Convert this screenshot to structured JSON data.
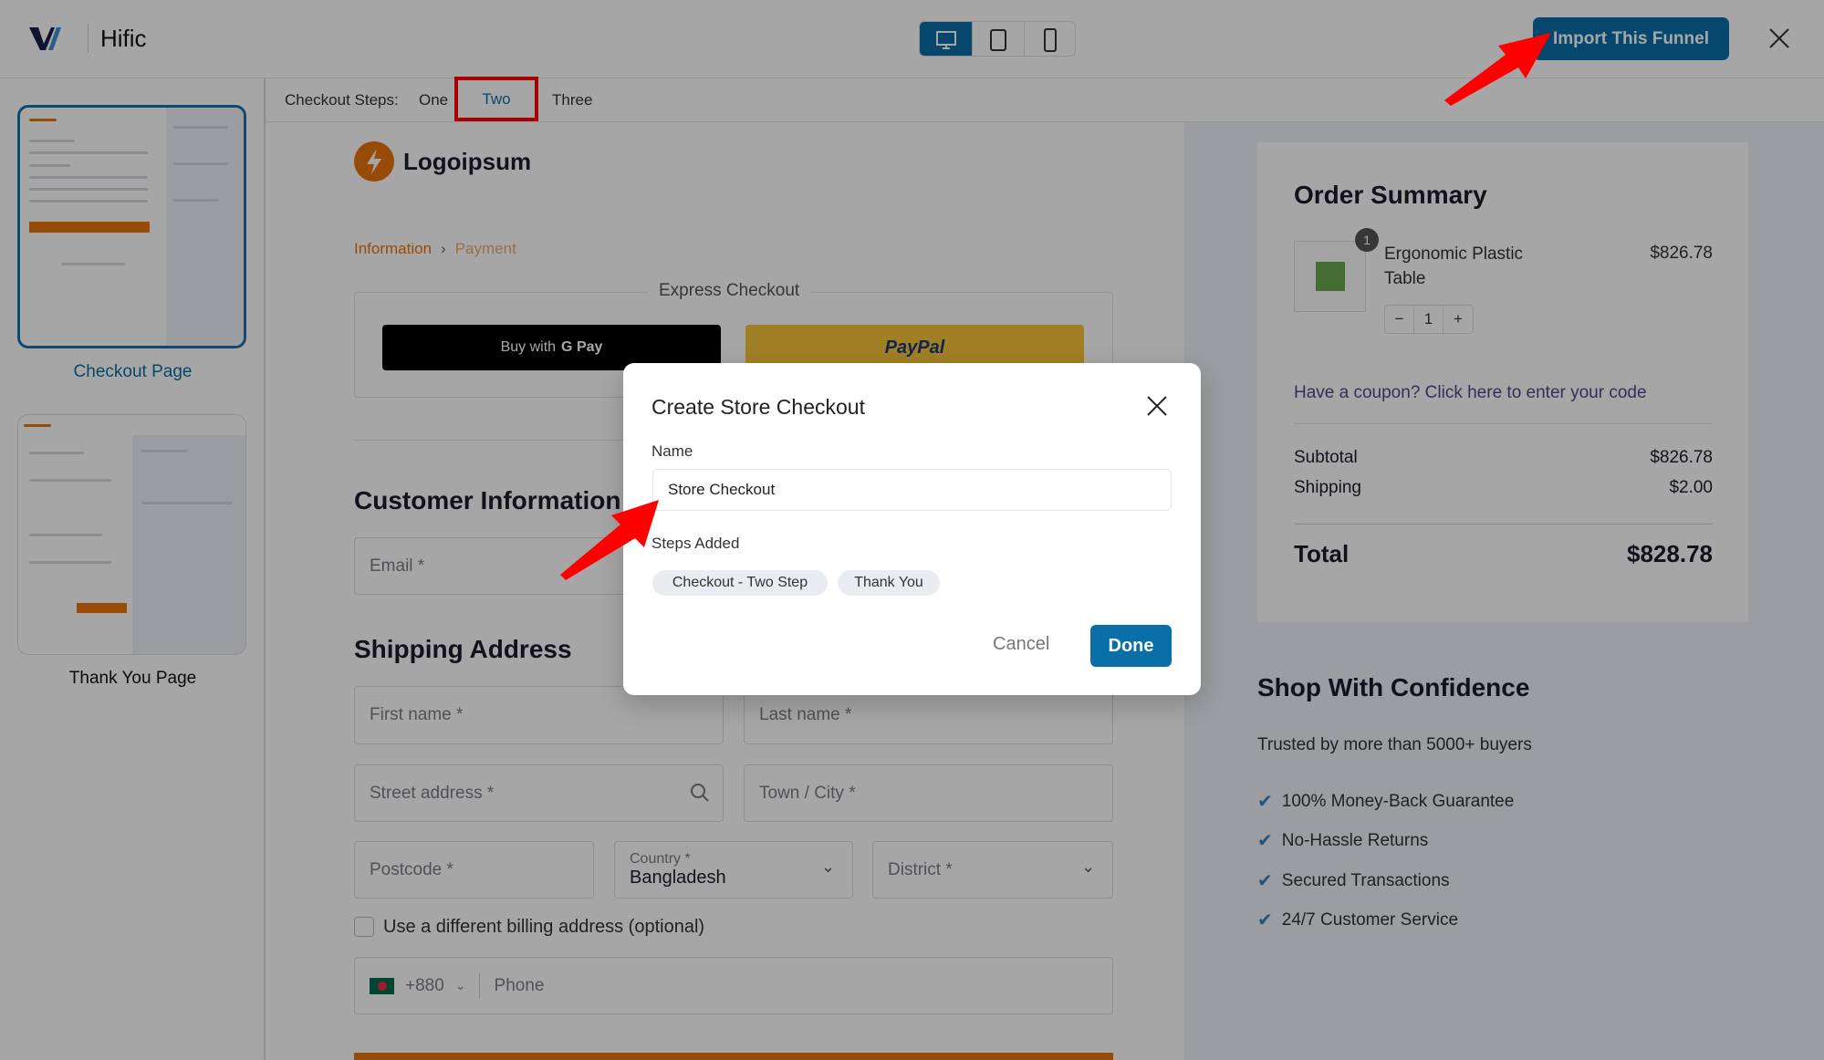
{
  "header": {
    "app_name": "Hific",
    "import_button": "Import This Funnel",
    "devices": [
      "desktop-icon",
      "tablet-icon",
      "mobile-icon"
    ],
    "active_device": "desktop"
  },
  "sidebar": {
    "items": [
      {
        "label": "Checkout Page",
        "selected": true
      },
      {
        "label": "Thank You Page",
        "selected": false
      }
    ]
  },
  "steps": {
    "label": "Checkout Steps:",
    "options": [
      "One",
      "Two",
      "Three"
    ],
    "selected": "Two"
  },
  "checkout": {
    "brand": "Logoipsum",
    "breadcrumb": [
      "Information",
      "Payment"
    ],
    "express_title": "Express Checkout",
    "gpay_label": "Buy with",
    "gpay_brand": "G Pay",
    "paypal_label": "PayPal",
    "customer_title": "Customer Information",
    "email_placeholder": "Email *",
    "shipping_title": "Shipping Address",
    "first_name": "First name *",
    "last_name": "Last name *",
    "street": "Street address *",
    "town": "Town / City *",
    "postcode": "Postcode *",
    "country_label": "Country *",
    "country_value": "Bangladesh",
    "district": "District *",
    "billing_checkbox": "Use a different billing address (optional)",
    "phone_code": "+880",
    "phone_placeholder": "Phone"
  },
  "order": {
    "title": "Order Summary",
    "product_name_1": "Ergonomic Plastic",
    "product_name_2": "Table",
    "product_price": "$826.78",
    "badge": "1",
    "qty": "1",
    "qty_minus": "−",
    "qty_plus": "+",
    "coupon": "Have a coupon? Click here to enter your code",
    "subtotal_label": "Subtotal",
    "subtotal": "$826.78",
    "shipping_label": "Shipping",
    "shipping": "$2.00",
    "total_label": "Total",
    "total": "$828.78"
  },
  "confidence": {
    "title": "Shop With Confidence",
    "subtitle": "Trusted by more than 5000+ buyers",
    "items": [
      "100% Money-Back Guarantee",
      "No-Hassle Returns",
      "Secured Transactions",
      "24/7 Customer Service"
    ]
  },
  "modal": {
    "title": "Create Store Checkout",
    "name_label": "Name",
    "name_value": "Store Checkout",
    "steps_label": "Steps Added",
    "steps": [
      "Checkout - Two Step",
      "Thank You"
    ],
    "cancel": "Cancel",
    "done": "Done"
  },
  "colors": {
    "primary": "#0a6ea8",
    "orange": "#e8740c",
    "annotation": "#ff0000",
    "accent_check": "#2f80c8"
  }
}
